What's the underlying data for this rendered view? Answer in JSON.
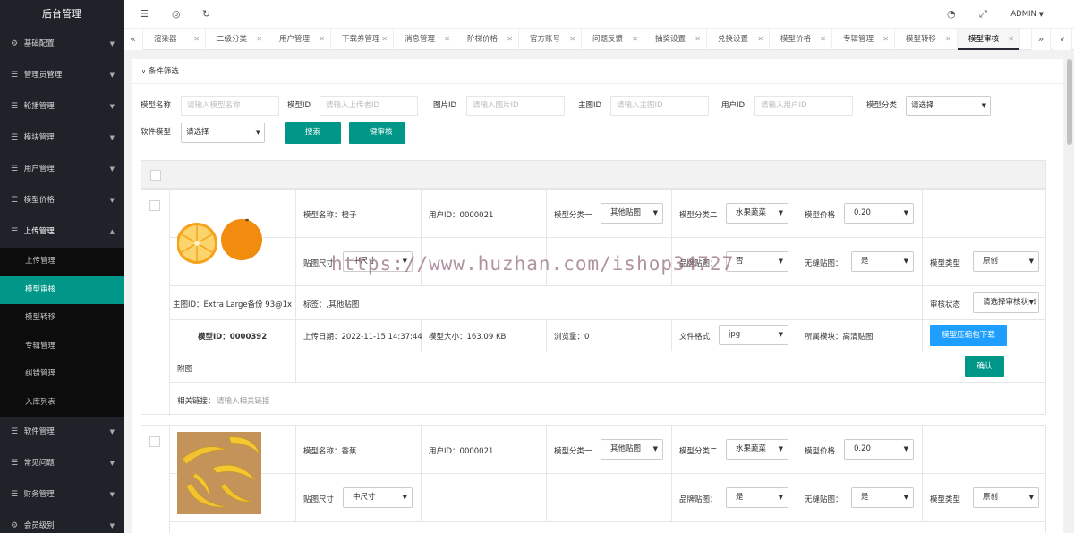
{
  "sidebar": {
    "title": "后台管理",
    "items": [
      {
        "label": "基础配置",
        "icon": "gear-icon",
        "expanded": false
      },
      {
        "label": "管理员管理",
        "icon": "sliders-icon",
        "expanded": false
      },
      {
        "label": "轮播管理",
        "icon": "sliders-icon",
        "expanded": false
      },
      {
        "label": "模块管理",
        "icon": "sliders-icon",
        "expanded": false
      },
      {
        "label": "用户管理",
        "icon": "sliders-icon",
        "expanded": false
      },
      {
        "label": "模型价格",
        "icon": "sliders-icon",
        "expanded": false
      },
      {
        "label": "上传管理",
        "icon": "sliders-icon",
        "expanded": true
      }
    ],
    "sub_items": [
      "上传管理",
      "模型审核",
      "模型转移",
      "专辑管理",
      "纠错管理",
      "入库列表"
    ],
    "active_sub": "模型审核",
    "items_after": [
      {
        "label": "软件管理",
        "icon": "sliders-icon"
      },
      {
        "label": "常见问题",
        "icon": "sliders-icon"
      },
      {
        "label": "财务管理",
        "icon": "sliders-icon"
      },
      {
        "label": "会员级别",
        "icon": "gear-icon"
      }
    ]
  },
  "header": {
    "admin_label": "ADMIN"
  },
  "tabs": {
    "items": [
      "渲染器",
      "二级分类",
      "用户管理",
      "下载券管理",
      "消息管理",
      "阶梯价格",
      "官方账号",
      "问题反馈",
      "抽奖设置",
      "兑换设置",
      "模型价格",
      "专辑管理",
      "模型转移",
      "模型审核"
    ],
    "active": "模型审核"
  },
  "filter": {
    "title": "条件筛选",
    "fields": [
      {
        "label": "模型名称",
        "placeholder": "请输入模型名称"
      },
      {
        "label": "模型ID",
        "placeholder": "请输入上传者ID"
      },
      {
        "label": "图片ID",
        "placeholder": "请输入图片ID"
      },
      {
        "label": "主图ID",
        "placeholder": "请输入主图ID"
      },
      {
        "label": "用户ID",
        "placeholder": "请输入用户ID"
      }
    ],
    "category_label": "模型分类",
    "category_value": "请选择",
    "software_label": "软件模型",
    "software_value": "请选择",
    "search_button": "搜索",
    "review_button": "一键审核"
  },
  "records": [
    {
      "image": "orange",
      "name": "模型名称：橙子",
      "user_id": "用户ID：0000021",
      "cat1_label": "模型分类一",
      "cat1_value": "其他贴图",
      "cat2_label": "模型分类二",
      "cat2_value": "水果蔬菜",
      "price_label": "模型价格",
      "price_value": "0.20",
      "size_label": "贴图尺寸",
      "size_value": "中尺寸",
      "brand_label": "品牌贴图：",
      "brand_value": "否",
      "seamless_label": "无缝贴图：",
      "seamless_value": "是",
      "type_label": "模型类型",
      "type_value": "原创",
      "main_id": "主图ID：Extra Large备份 93@1x",
      "tags": "标签：,其他贴图",
      "review_label": "审核状态",
      "review_value": "请选择审核状态",
      "model_id": "模型ID：0000392",
      "upload_date": "上传日期：2022-11-15 14:37:44",
      "model_size": "模型大小：163.09 KB",
      "views": "浏览量：0",
      "format_label": "文件格式",
      "format_value": "jpg",
      "module": "所属模块：高清贴图",
      "download_button": "模型压缩包下载",
      "attachment_label": "附图",
      "confirm_button": "确认",
      "link_label": "相关链接：",
      "link_placeholder": "请输入相关链接"
    },
    {
      "image": "banana",
      "name": "模型名称：香蕉",
      "user_id": "用户ID：0000021",
      "cat1_label": "模型分类一",
      "cat1_value": "其他贴图",
      "cat2_label": "模型分类二",
      "cat2_value": "水果蔬菜",
      "price_label": "模型价格",
      "price_value": "0.20",
      "size_label": "贴图尺寸",
      "size_value": "中尺寸",
      "brand_label": "品牌贴图：",
      "brand_value": "是",
      "seamless_label": "无缝贴图：",
      "seamless_value": "是",
      "type_label": "模型类型",
      "type_value": "原创"
    }
  ],
  "watermark": "https://www.huzhan.com/ishop34727",
  "colors": {
    "sidebar_bg": "#20222a",
    "accent": "#009688",
    "blue": "#1e9fff"
  }
}
